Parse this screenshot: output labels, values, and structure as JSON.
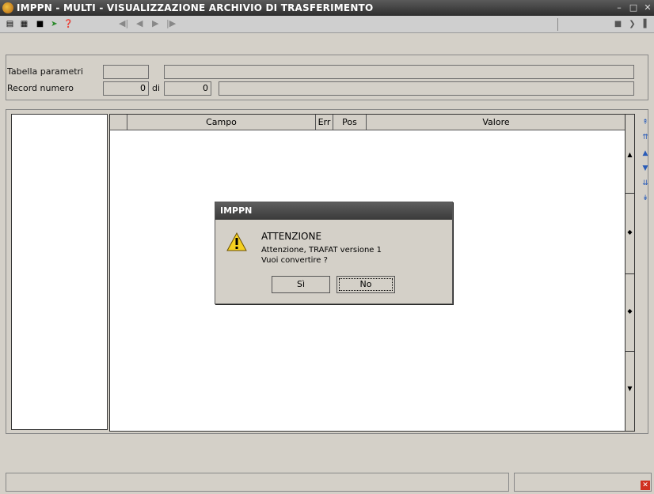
{
  "window": {
    "title": "IMPPN  - MULTI -  VISUALIZZAZIONE ARCHIVIO DI TRASFERIMENTO",
    "controls": [
      "minimize",
      "maximize",
      "close"
    ]
  },
  "toolbar": {
    "icons": [
      "window-icon",
      "print-icon",
      "stamp-icon",
      "export-icon",
      "help-icon"
    ],
    "nav": [
      "first-record",
      "previous-record",
      "next-record",
      "last-record"
    ],
    "right_icons": [
      "layout-icon",
      "exit-icon"
    ]
  },
  "params": {
    "tabella_label": "Tabella parametri",
    "tabella_code": "",
    "tabella_desc": "",
    "record_label": "Record numero",
    "record_value": "0",
    "di_label": "di",
    "record_total": "0",
    "record_desc": ""
  },
  "grid": {
    "columns": [
      "",
      "Campo",
      "Err",
      "Pos",
      "Valore"
    ],
    "rows": []
  },
  "dialog": {
    "title": "IMPPN",
    "heading": "ATTENZIONE",
    "message_1": "Attenzione, TRAFAT versione 1",
    "message_2": "Vuoi convertire ?",
    "yes_label": "Sì",
    "no_label": "No"
  },
  "colors": {
    "titlebar": "#3a3a3a",
    "background": "#d4d0c8",
    "nav_arrows": "#2a5cb8",
    "close_red": "#d03020"
  }
}
